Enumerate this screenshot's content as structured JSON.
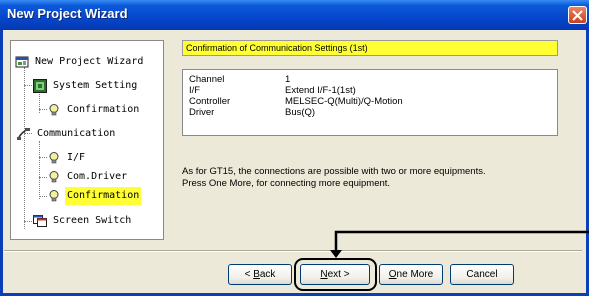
{
  "window": {
    "title": "New Project Wizard"
  },
  "tree": {
    "items": [
      {
        "label": "New Project Wizard",
        "icon": "wizard-icon"
      },
      {
        "label": "System Setting",
        "icon": "system-setting-icon"
      },
      {
        "label": "Confirmation",
        "icon": "bulb-icon"
      },
      {
        "label": "Communication",
        "icon": "communication-icon"
      },
      {
        "label": "I/F",
        "icon": "bulb-icon"
      },
      {
        "label": "Com.Driver",
        "icon": "bulb-icon"
      },
      {
        "label": "Confirmation",
        "icon": "bulb-icon",
        "selected": true
      },
      {
        "label": "Screen Switch",
        "icon": "screen-switch-icon"
      }
    ]
  },
  "main": {
    "header": "Confirmation of Communication Settings (1st)",
    "settings": [
      {
        "key": "Channel",
        "value": "1"
      },
      {
        "key": "I/F",
        "value": "Extend I/F-1(1st)"
      },
      {
        "key": "Controller",
        "value": "MELSEC-Q(Multi)/Q-Motion"
      },
      {
        "key": "Driver",
        "value": "Bus(Q)"
      }
    ],
    "note_line1": "As for GT15, the connections are possible with two or more equipments.",
    "note_line2": "Press One More, for connecting more equipment."
  },
  "buttons": {
    "back": {
      "prefix": "< ",
      "mnemonic": "B",
      "rest": "ack"
    },
    "next": {
      "mnemonic": "N",
      "rest": "ext >"
    },
    "one_more": {
      "mnemonic": "O",
      "rest": "ne More"
    },
    "cancel": "Cancel"
  },
  "colors": {
    "titlebar": "#0a5ad8",
    "highlight": "#ffff33",
    "close": "#c6411d"
  }
}
